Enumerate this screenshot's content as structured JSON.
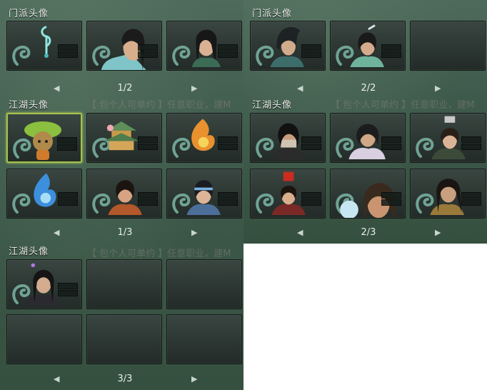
{
  "panels": [
    {
      "sections": [
        {
          "title": "门派头像",
          "ghost": "",
          "page": "1/2",
          "slots": [
            "sect-emblem",
            "sect-master-male",
            "sect-swordsman",
            "",
            "",
            ""
          ]
        },
        {
          "title": "江湖头像",
          "ghost": "【 包个人可单约 】任意职业，建M",
          "page": "1/3",
          "slots": [
            "leaf-mascot",
            "pagoda",
            "flame-crest",
            "water-crest",
            "young-hero",
            "headband-hero"
          ]
        },
        {
          "title": "江湖头像",
          "ghost": "【 包个人可单约 】任意职业，建M",
          "page": "3/3",
          "slots": [
            "dark-hair-hero",
            "empty",
            "empty",
            "empty",
            "empty",
            "empty"
          ]
        }
      ]
    },
    {
      "sections": [
        {
          "title": "门派头像",
          "ghost": "",
          "page": "2/2",
          "slots": [
            "hooded-warrior",
            "green-disciple",
            "empty",
            "",
            "",
            ""
          ]
        },
        {
          "title": "江湖头像",
          "ghost": "【 包个人可单约 】任意职业，建M",
          "page": "2/3",
          "slots": [
            "masked-assassin",
            "fur-collar-hero",
            "crowned-youth",
            "red-hat-official",
            "curly-hair-lady",
            "long-hair-hero"
          ]
        }
      ]
    }
  ],
  "arrows": {
    "prev": "◀",
    "next": "▶"
  },
  "colors": {
    "panel_bg": "#3e5a4c",
    "slot_bg": "#2b3531",
    "selected_border": "#a6c24a",
    "text": "#ecf2ec"
  }
}
